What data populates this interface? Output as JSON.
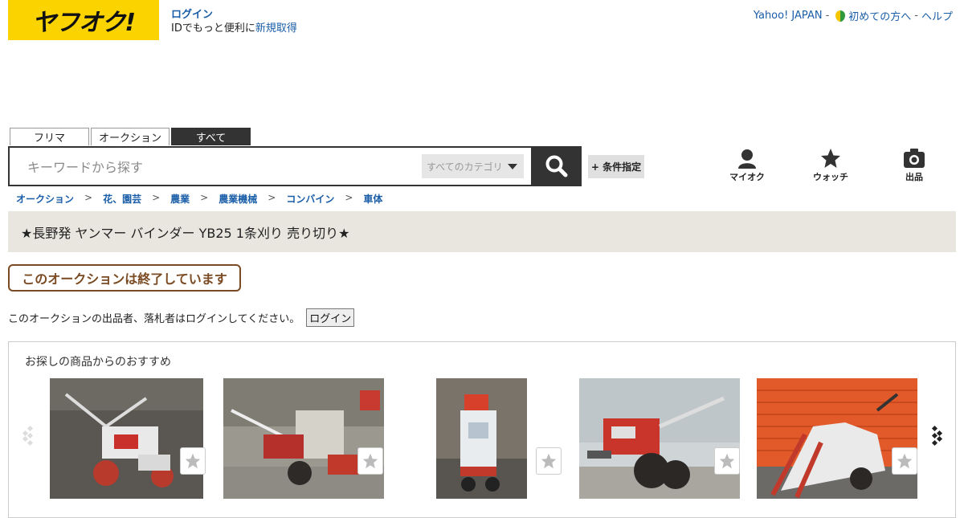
{
  "header": {
    "logo_text": "ヤフオク!",
    "login_label": "ログイン",
    "login_sub_text": "IDでもっと便利に",
    "register_label": "新規取得",
    "links": {
      "yahoo_japan": "Yahoo! JAPAN",
      "beginner": "初めての方へ",
      "help": "ヘルプ",
      "separator": "-"
    }
  },
  "search": {
    "tabs": [
      {
        "label": "フリマ",
        "active": false
      },
      {
        "label": "オークション",
        "active": false
      },
      {
        "label": "すべて",
        "active": true
      }
    ],
    "placeholder": "キーワードから探す",
    "category_label": "すべてのカテゴリ",
    "condition_label": "+ 条件指定"
  },
  "nav": {
    "my_auction": "マイオク",
    "watch": "ウォッチ",
    "sell": "出品"
  },
  "breadcrumb": [
    "オークション",
    "花、園芸",
    "農業",
    "農業機械",
    "コンバイン",
    "車体"
  ],
  "breadcrumb_separator": ">",
  "item": {
    "title": "★長野発 ヤンマー バインダー YB25 1条刈り 売り切り★",
    "ended_label": "このオークションは終了しています",
    "login_notice": "このオークションの出品者、落札者はログインしてください。",
    "login_button": "ログイン"
  },
  "recommend": {
    "title": "お探しの商品からのおすすめ",
    "items": [
      {
        "name": "tiller-photo"
      },
      {
        "name": "binder-photo"
      },
      {
        "name": "cart-photo"
      },
      {
        "name": "walk-tractor-photo"
      },
      {
        "name": "harvester-photo"
      }
    ]
  },
  "colors": {
    "brand_yellow": "#fbd400",
    "link_blue": "#1a5ea8",
    "ended_brown": "#7a4a22",
    "title_bg": "#e8e6df",
    "dark": "#333333"
  }
}
